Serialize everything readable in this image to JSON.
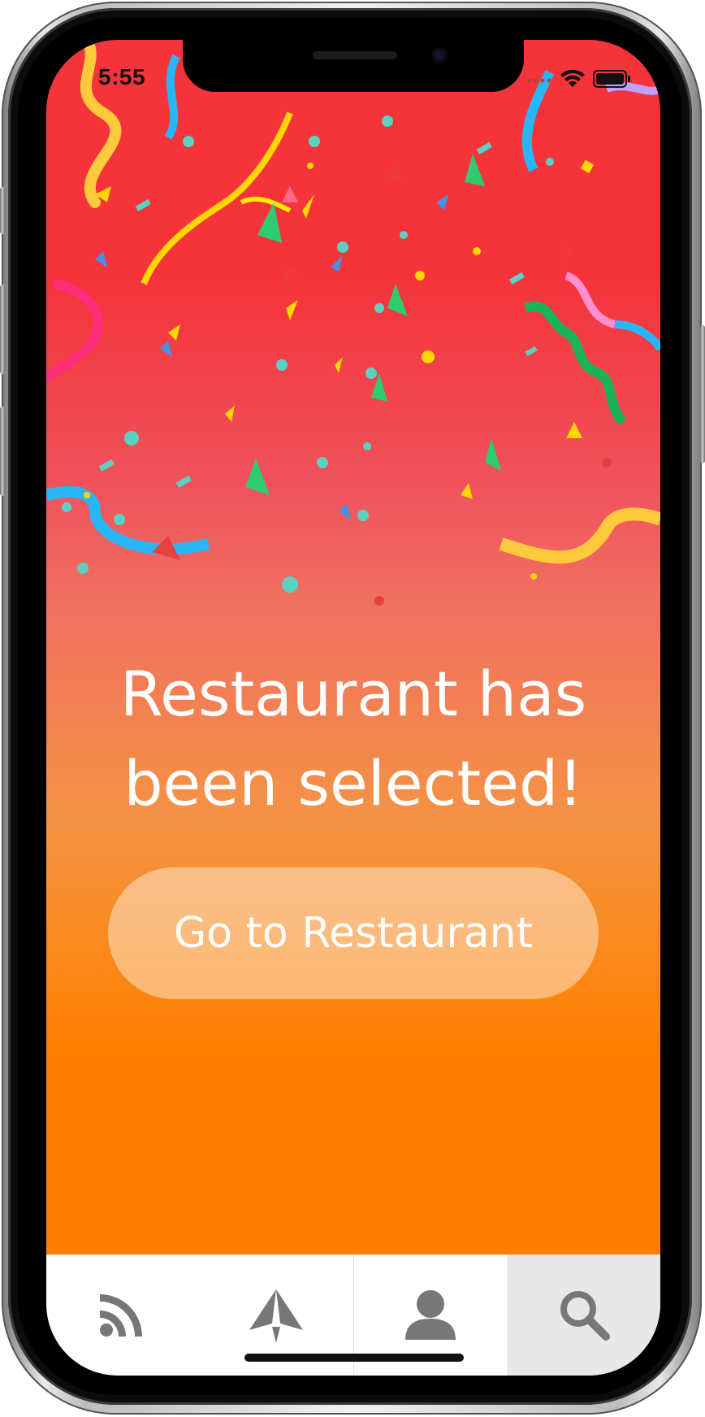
{
  "status_bar": {
    "time": "5:55"
  },
  "main": {
    "headline_line1": "Restaurant has",
    "headline_line2": "been selected!",
    "button_label": "Go to Restaurant"
  },
  "tab_bar": {
    "tabs": [
      {
        "icon": "feed-icon",
        "active": false
      },
      {
        "icon": "send-icon",
        "active": false
      },
      {
        "icon": "profile-icon",
        "active": false
      },
      {
        "icon": "search-icon",
        "active": true
      }
    ]
  },
  "colors": {
    "gradient_top": "#f4343a",
    "gradient_bottom": "#ff7e00",
    "tab_icon": "#777777",
    "active_tab_bg": "#e8e8e8"
  }
}
